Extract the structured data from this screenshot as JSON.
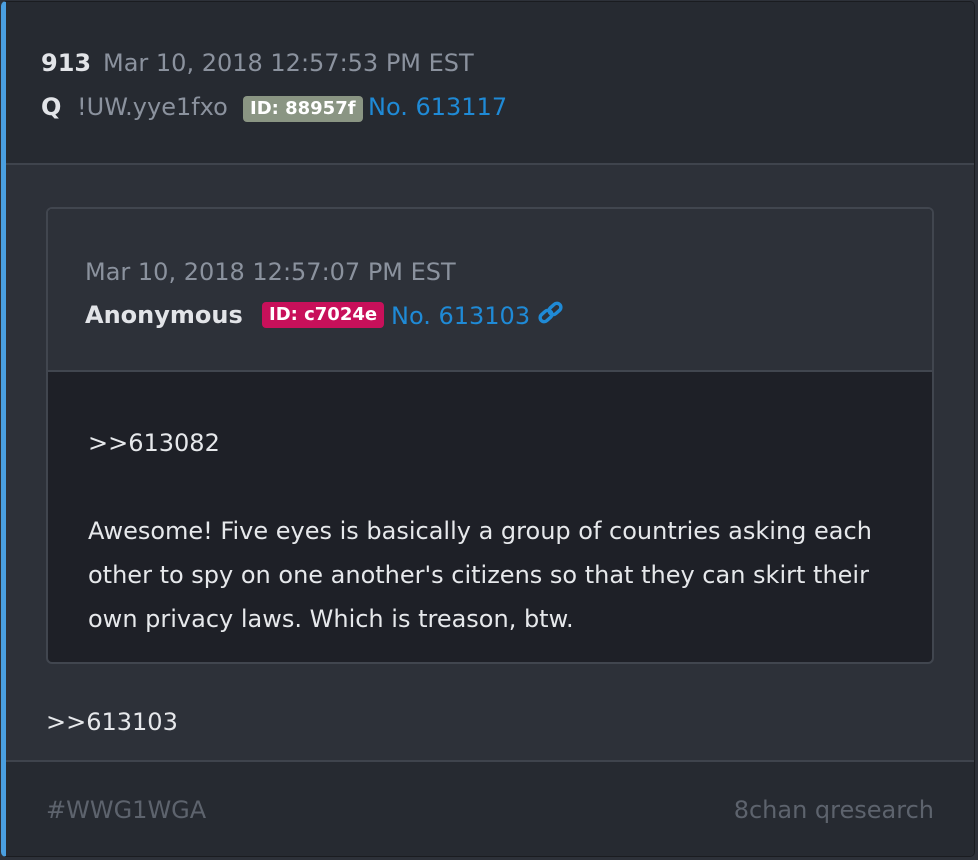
{
  "header": {
    "post_number": "913",
    "date": "Mar 10, 2018 12:57:53 PM EST",
    "author": "Q",
    "tripcode": "!UW.yye1fxo",
    "id_badge": "ID: 88957f",
    "id_badge_color": "#8a9583",
    "post_link": "No. 613117"
  },
  "quoted_post": {
    "date": "Mar 10, 2018 12:57:07 PM EST",
    "author": "Anonymous",
    "id_badge": "ID: c7024e",
    "id_badge_color": "#c8105a",
    "post_link": "No. 613103",
    "link_icon": "chain-link-icon",
    "body": {
      "reference": ">>613082",
      "text": "Awesome!  Five eyes is basically a group of countries asking each other to spy on one another's citizens so that they can skirt their own privacy laws.  Which is treason, btw."
    }
  },
  "reply": {
    "reference": ">>613103"
  },
  "footer": {
    "hashtag": "#WWG1WGA",
    "source": "8chan qresearch"
  },
  "colors": {
    "accent": "#4a9fe0",
    "link": "#1f8ad6",
    "background": "#2d3139"
  }
}
